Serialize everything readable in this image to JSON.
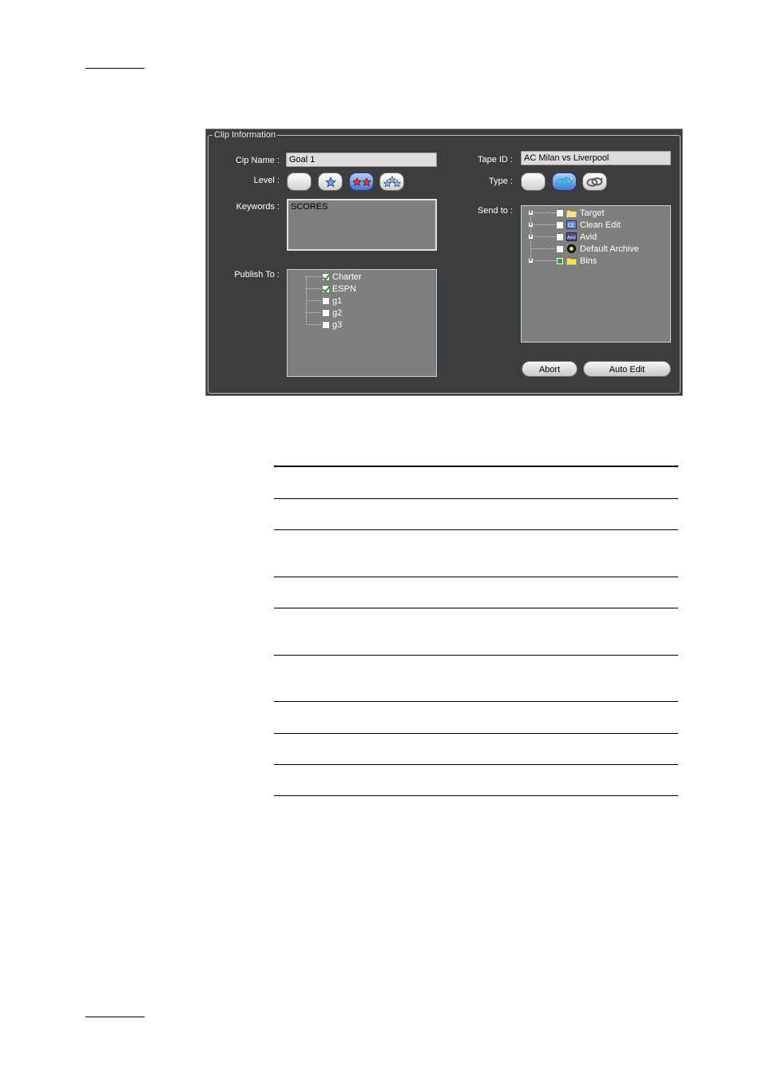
{
  "dialog": {
    "group_title": "Clip Information",
    "clip_name": {
      "label": "Cip Name :",
      "value": "Goal 1"
    },
    "level": {
      "label": "Level  :",
      "buttons": [
        {
          "icon": "no-star-icon",
          "selected": false
        },
        {
          "icon": "one-star-icon",
          "selected": false
        },
        {
          "icon": "two-stars-icon",
          "selected": true
        },
        {
          "icon": "three-stars-icon",
          "selected": false
        }
      ]
    },
    "keywords": {
      "label": "Keywords :",
      "value": "SCORES"
    },
    "publish_to": {
      "label": "Publish To :",
      "items": [
        {
          "label": "Charter",
          "checked": true
        },
        {
          "label": "ESPN",
          "checked": true
        },
        {
          "label": "g1",
          "checked": false
        },
        {
          "label": "g2",
          "checked": false
        },
        {
          "label": "g3",
          "checked": false
        }
      ]
    },
    "tape_id": {
      "label": "Tape ID :",
      "value": "AC Milan vs Liverpool"
    },
    "type": {
      "label": "Type :",
      "buttons": [
        {
          "icon": "no-type-icon",
          "selected": false
        },
        {
          "icon": "clip-type-blue-icon",
          "selected": true
        },
        {
          "icon": "clip-type-grey-icon",
          "selected": false
        }
      ]
    },
    "send_to": {
      "label": "Send to :",
      "items": [
        {
          "label": "Target",
          "icon": "folder-icon",
          "expandable": true,
          "state": "unchecked"
        },
        {
          "label": "Clean Edit",
          "icon": "clean-edit-icon",
          "expandable": true,
          "state": "unchecked"
        },
        {
          "label": "Avid",
          "icon": "avid-icon",
          "expandable": true,
          "state": "unchecked"
        },
        {
          "label": "Default Archive",
          "icon": "archive-icon",
          "expandable": false,
          "state": "unchecked"
        },
        {
          "label": "Bins",
          "icon": "bin-folder-icon",
          "expandable": true,
          "state": "partial"
        }
      ]
    },
    "abort_label": "Abort",
    "auto_edit_label": "Auto Edit"
  }
}
